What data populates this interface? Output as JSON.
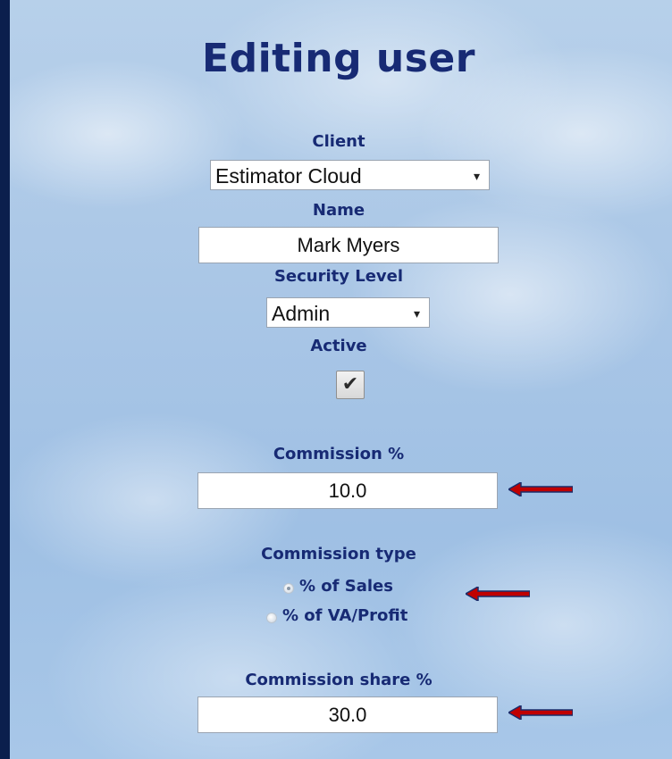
{
  "page": {
    "title": "Editing user"
  },
  "form": {
    "client": {
      "label": "Client",
      "value": "Estimator Cloud"
    },
    "name": {
      "label": "Name",
      "value": "Mark Myers"
    },
    "security_level": {
      "label": "Security Level",
      "value": "Admin"
    },
    "active": {
      "label": "Active",
      "checked": true
    },
    "commission_percent": {
      "label": "Commission %",
      "value": "10.0"
    },
    "commission_type": {
      "label": "Commission type",
      "options": [
        {
          "label": "% of Sales",
          "selected": true
        },
        {
          "label": "% of VA/Profit",
          "selected": false
        }
      ]
    },
    "commission_share_percent": {
      "label": "Commission share %",
      "value": "30.0"
    }
  },
  "icons": {
    "checkmark": "checkmark-icon",
    "dropdown": "chevron-down-icon",
    "annotation_arrow": "left-arrow-icon"
  },
  "colors": {
    "label": "#172a74",
    "arrow": "#c00000",
    "frame": "#0b1f4d"
  }
}
